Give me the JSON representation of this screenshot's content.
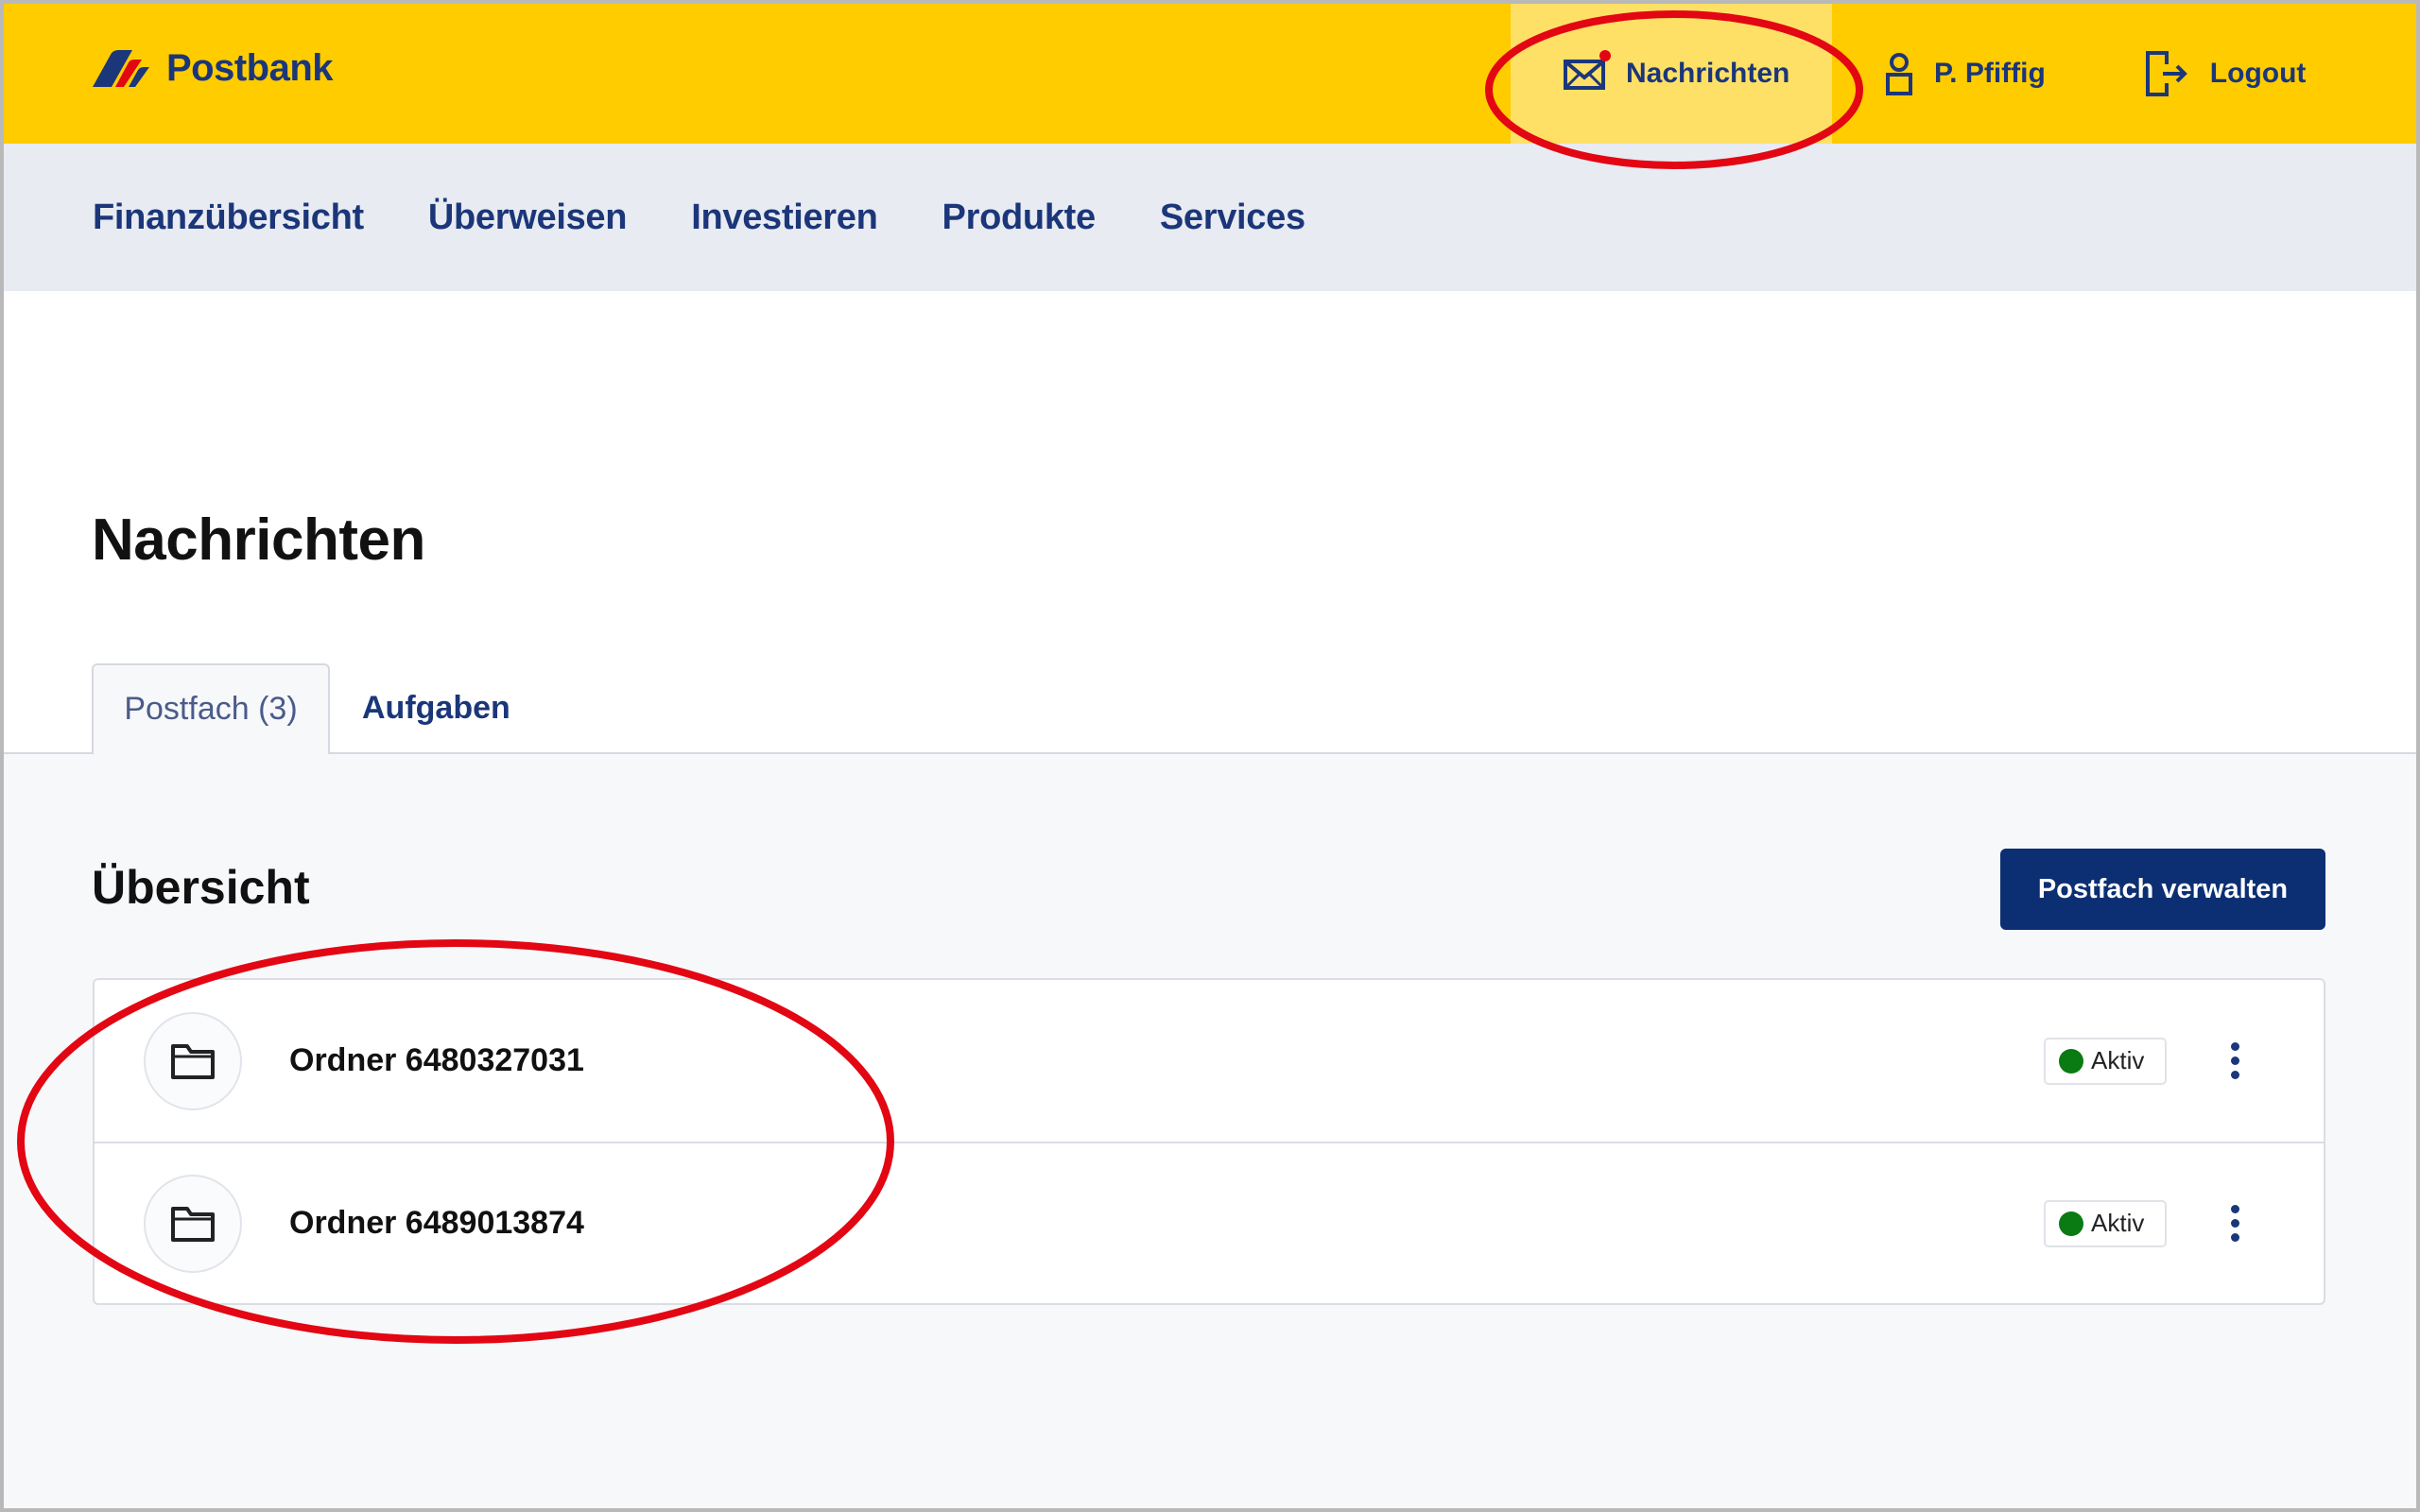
{
  "brand": {
    "name": "Postbank",
    "colors": {
      "yellow": "#ffcc00",
      "navy": "#1b3679",
      "red": "#e30613",
      "button": "#0c2f73"
    }
  },
  "header": {
    "actions": [
      {
        "label": "Nachrichten",
        "icon": "envelope-icon",
        "has_notification": true,
        "active": true
      },
      {
        "label": "P. Pfiffig",
        "icon": "user-icon"
      },
      {
        "label": "Logout",
        "icon": "logout-icon"
      }
    ]
  },
  "nav": {
    "items": [
      {
        "label": "Finanzübersicht"
      },
      {
        "label": "Überweisen"
      },
      {
        "label": "Investieren"
      },
      {
        "label": "Produkte"
      },
      {
        "label": "Services"
      }
    ]
  },
  "page": {
    "title": "Nachrichten",
    "tabs": [
      {
        "label": "Postfach (3)",
        "active": true
      },
      {
        "label": "Aufgaben",
        "active": false
      }
    ]
  },
  "overview": {
    "title": "Übersicht",
    "manage_button": "Postfach verwalten",
    "folders": [
      {
        "name": "Ordner 6480327031",
        "status": "Aktiv",
        "status_color": "#0a7a12"
      },
      {
        "name": "Ordner 6489013874",
        "status": "Aktiv",
        "status_color": "#0a7a12"
      }
    ]
  },
  "annotations": {
    "color": "#e30613",
    "highlighted": [
      "header-nachrichten",
      "folder-list"
    ]
  }
}
